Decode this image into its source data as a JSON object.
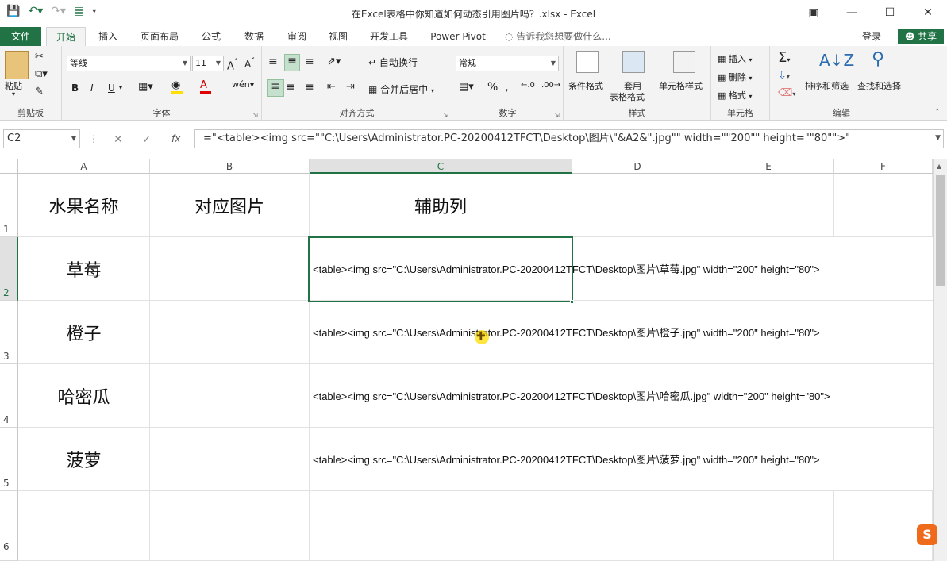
{
  "window": {
    "title": "在Excel表格中你知道如何动态引用图片吗？.xlsx - Excel",
    "icons": [
      "save-icon",
      "undo-icon",
      "redo-icon",
      "form-icon",
      "customize-qat-icon"
    ],
    "controls": [
      "ribbon-display-icon",
      "minimize-icon",
      "maximize-icon",
      "close-icon"
    ]
  },
  "tabs": [
    "文件",
    "开始",
    "插入",
    "页面布局",
    "公式",
    "数据",
    "审阅",
    "视图",
    "开发工具",
    "Power Pivot"
  ],
  "tell_me": "告诉我您想要做什么...",
  "login": "登录",
  "share": "共享",
  "ribbon": {
    "clipboard": {
      "paste": "粘贴",
      "label": "剪贴板"
    },
    "font": {
      "name": "等线",
      "size": "11",
      "label": "字体",
      "bold": "B",
      "italic": "I",
      "underline": "U"
    },
    "alignment": {
      "wrap": "自动换行",
      "merge": "合并后居中",
      "label": "对齐方式"
    },
    "number": {
      "format": "常规",
      "label": "数字",
      "percent": "%",
      "comma": ","
    },
    "styles": {
      "cond": "条件格式",
      "table1": "套用",
      "table2": "表格格式",
      "cell": "单元格样式",
      "label": "样式"
    },
    "cells": {
      "insert": "插入",
      "delete": "删除",
      "format": "格式",
      "label": "单元格"
    },
    "editing": {
      "sort": "排序和筛选",
      "find": "查找和选择",
      "label": "编辑"
    }
  },
  "formula_bar": {
    "name_box": "C2",
    "fx": "fx",
    "formula": "=\"<table><img src=\"\"C:\\Users\\Administrator.PC-20200412TFCT\\Desktop\\图片\\\"&A2&\".jpg\"\" width=\"\"200\"\" height=\"\"80\"\">\""
  },
  "columns": [
    "A",
    "B",
    "C",
    "D",
    "E",
    "F"
  ],
  "rows": [
    "1",
    "2",
    "3",
    "4",
    "5",
    "6"
  ],
  "cells": {
    "A1": "水果名称",
    "B1": "对应图片",
    "C1": "辅助列",
    "A2": "草莓",
    "C2": "<table><img src=\"C:\\Users\\Administrator.PC-20200412TFCT\\Desktop\\图片\\草莓.jpg\" width=\"200\" height=\"80\">",
    "A3": "橙子",
    "C3": "<table><img src=\"C:\\Users\\Administrator.PC-20200412TFCT\\Desktop\\图片\\橙子.jpg\" width=\"200\" height=\"80\">",
    "A4": "哈密瓜",
    "C4": "<table><img src=\"C:\\Users\\Administrator.PC-20200412TFCT\\Desktop\\图片\\哈密瓜.jpg\" width=\"200\" height=\"80\">",
    "A5": "菠萝",
    "C5": "<table><img src=\"C:\\Users\\Administrator.PC-20200412TFCT\\Desktop\\图片\\菠萝.jpg\" width=\"200\" height=\"80\">"
  },
  "colors": {
    "accent": "#217346",
    "cursor": "#ffdc00",
    "sogou": "#f06a1c"
  },
  "ime_badge": "S"
}
